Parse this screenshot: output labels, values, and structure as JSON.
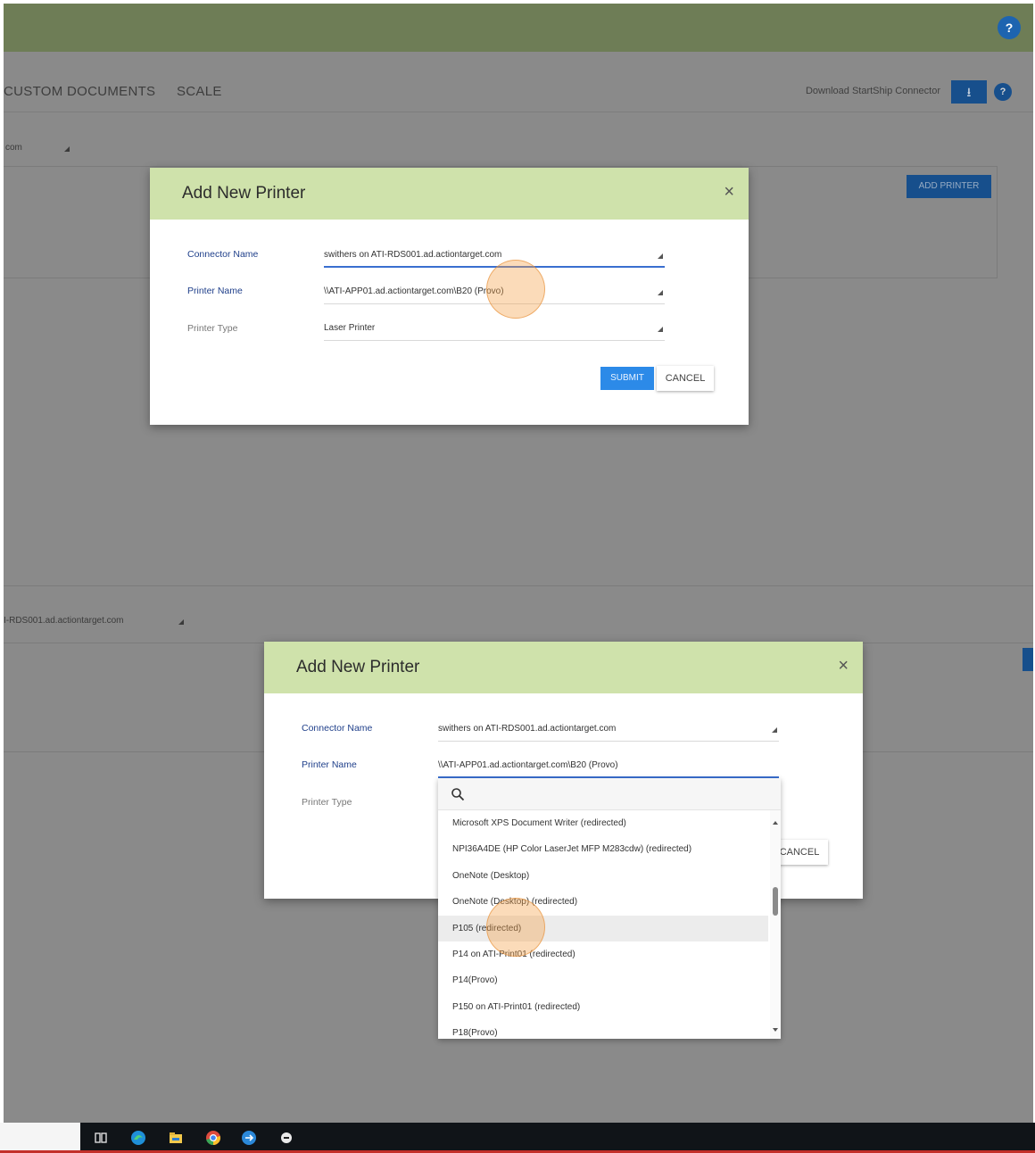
{
  "app": {
    "tabs": [
      "CUSTOM DOCUMENTS",
      "SCALE"
    ],
    "download_connector_label": "Download StartShip Connector",
    "download_icon": "download-icon",
    "help_icon": "help-icon",
    "connector_select_top": "com",
    "connector_select_bottom": "I-RDS001.ad.actiontarget.com",
    "add_printer_label": "ADD PRINTER"
  },
  "modal_top": {
    "title": "Add New Printer",
    "close_glyph": "×",
    "connector_label": "Connector Name",
    "connector_value": "swithers on ATI-RDS001.ad.actiontarget.com",
    "printer_label": "Printer Name",
    "printer_value": "\\\\ATI-APP01.ad.actiontarget.com\\B20 (Provo)",
    "type_label": "Printer Type",
    "type_value": "Laser Printer",
    "submit_label": "SUBMIT",
    "cancel_label": "CANCEL"
  },
  "modal_bottom": {
    "title": "Add New Printer",
    "close_glyph": "×",
    "connector_label": "Connector Name",
    "connector_value": "swithers on ATI-RDS001.ad.actiontarget.com",
    "printer_label": "Printer Name",
    "printer_value": "\\\\ATI-APP01.ad.actiontarget.com\\B20 (Provo)",
    "type_label": "Printer Type",
    "cancel_label": "CANCEL"
  },
  "dropdown": {
    "search_icon": "search-icon",
    "items": [
      "Microsoft XPS Document Writer (redirected)",
      "NPI36A4DE (HP Color LaserJet MFP M283cdw) (redirected)",
      "OneNote (Desktop)",
      "OneNote (Desktop) (redirected)",
      "P105 (redirected)",
      "P14 on ATI-Print01 (redirected)",
      "P14(Provo)",
      "P150 on ATI-Print01 (redirected)",
      "P18(Provo)"
    ],
    "highlighted_index": 4
  },
  "taskbar": {
    "icons": [
      "task-view-icon",
      "edge-icon",
      "file-explorer-icon",
      "chrome-icon",
      "remote-desktop-icon",
      "app-icon"
    ]
  },
  "colors": {
    "header_green": "#cfe2ab",
    "topbar_dim": "#6e7d56",
    "primary_blue": "#2c8ae8",
    "click_highlight": "#f5a046"
  }
}
